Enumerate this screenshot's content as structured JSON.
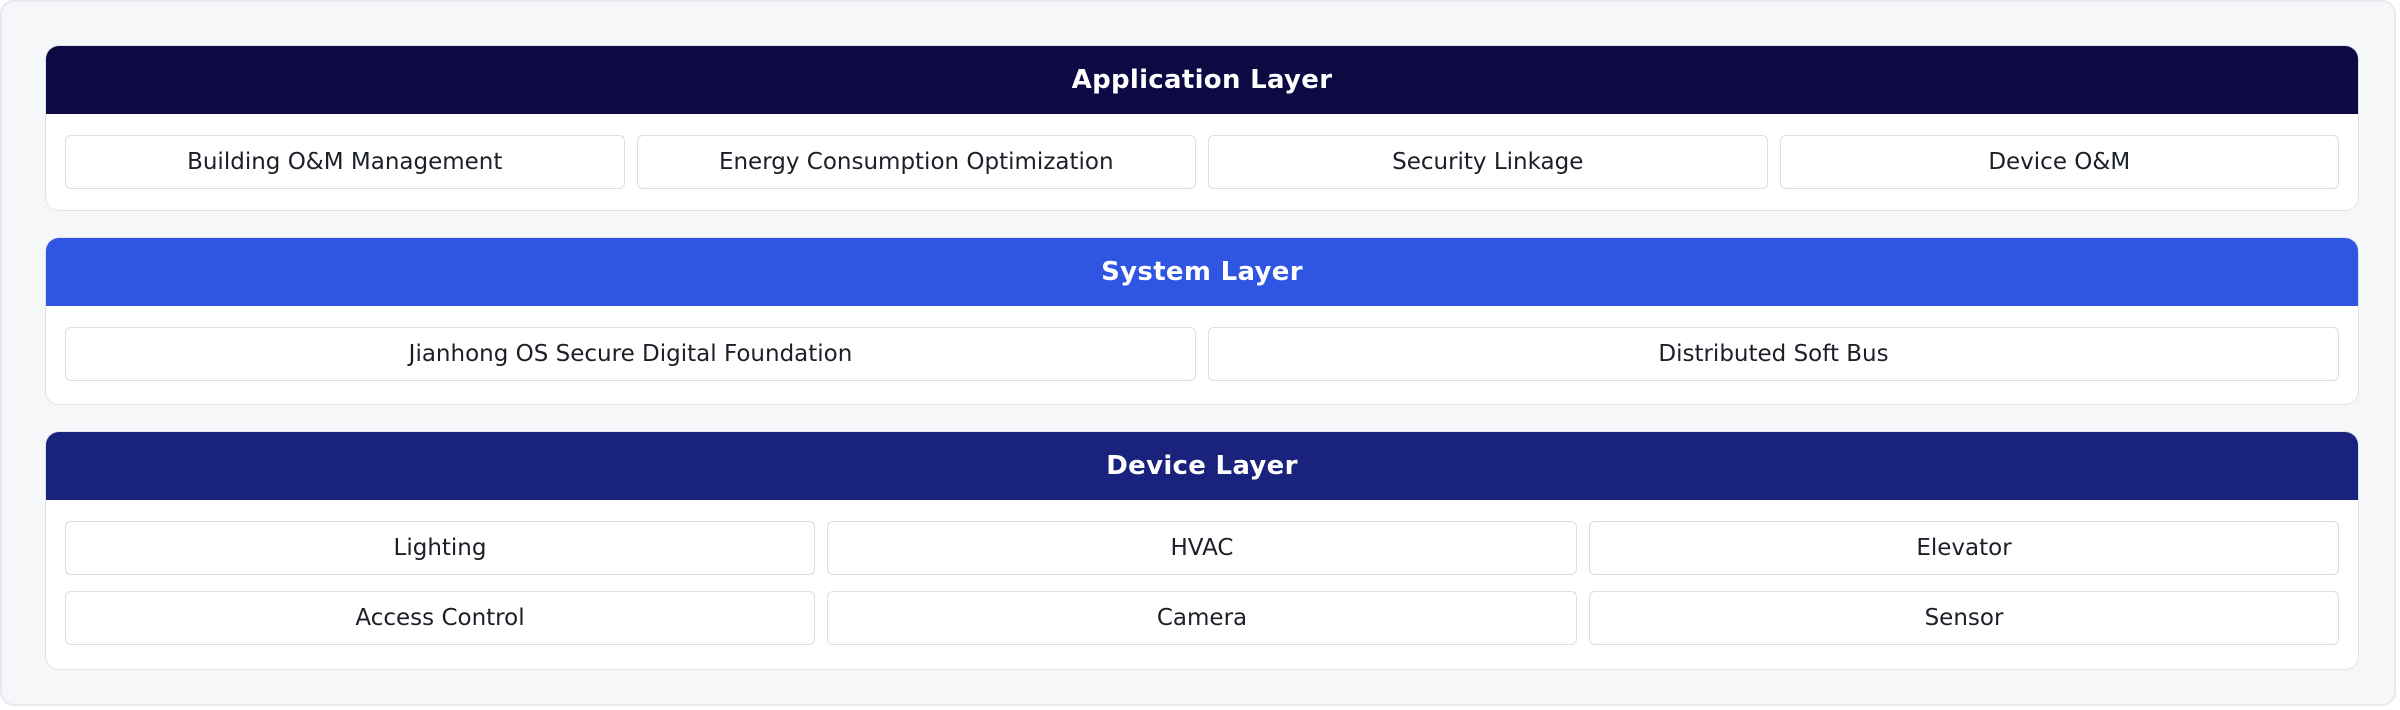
{
  "colors": {
    "application_header": "#0d0a43",
    "system_header": "#2f56e2",
    "device_header": "#19237d",
    "cell_border": "#d9dde4",
    "frame_background": "#f6f7f9"
  },
  "layers": [
    {
      "title": "Application Layer",
      "items": [
        "Building O&M Management",
        "Energy Consumption Optimization",
        "Security Linkage",
        "Device O&M"
      ]
    },
    {
      "title": "System Layer",
      "items": [
        "Jianhong OS Secure Digital Foundation",
        "Distributed Soft Bus"
      ]
    },
    {
      "title": "Device Layer",
      "items": [
        "Lighting",
        "HVAC",
        "Elevator",
        "Access Control",
        "Camera",
        "Sensor"
      ]
    }
  ]
}
